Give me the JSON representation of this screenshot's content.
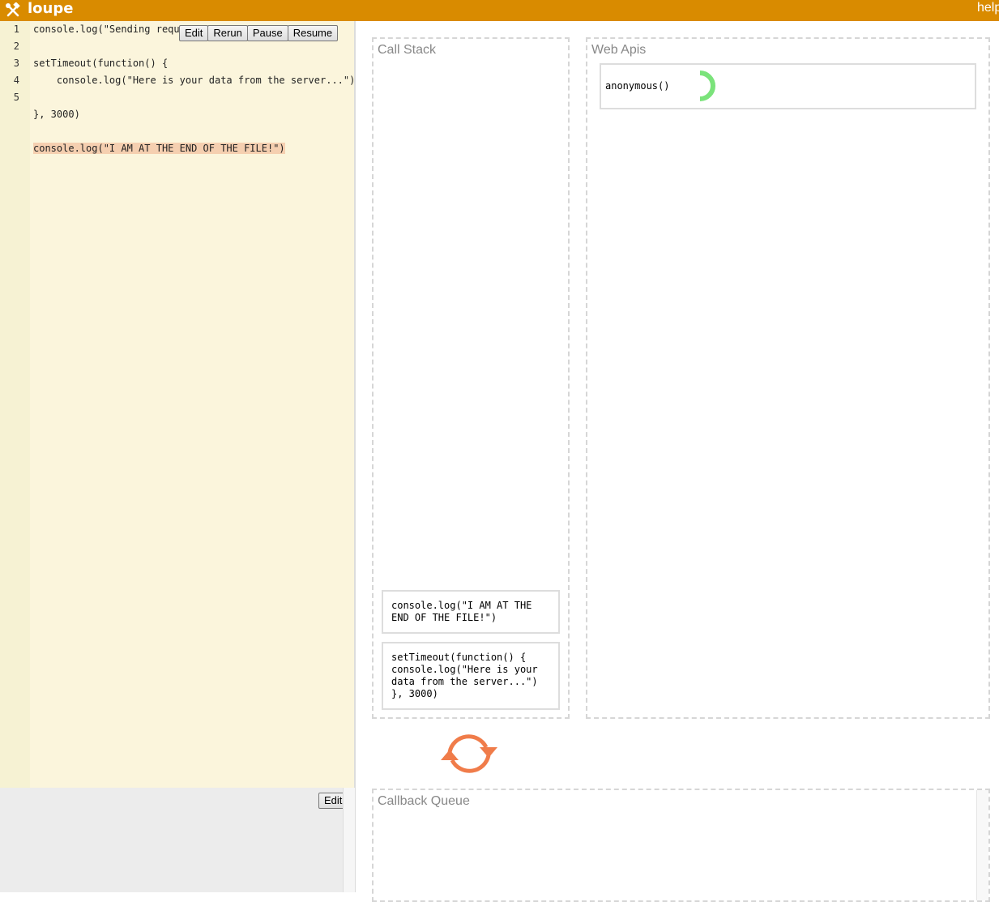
{
  "app": {
    "name": "loupe",
    "help_label": "help"
  },
  "editor": {
    "line_numbers": [
      "1",
      "2",
      "3",
      "4",
      "5"
    ],
    "lines": [
      "console.log(\"Sending requ",
      "",
      "setTimeout(function() {",
      "    console.log(\"Here is your data from the server...\")",
      "",
      "}, 3000)",
      "",
      "console.log(\"I AM AT THE END OF THE FILE!\")"
    ],
    "toolbar": {
      "edit": "Edit",
      "rerun": "Rerun",
      "pause": "Pause",
      "resume": "Resume"
    }
  },
  "console": {
    "edit": "Edit"
  },
  "call_stack": {
    "title": "Call Stack",
    "frames": [
      "console.log(\"I AM AT THE END OF THE FILE!\")",
      "setTimeout(function() { console.log(\"Here is your data from the server...\") }, 3000)"
    ]
  },
  "web_apis": {
    "title": "Web Apis",
    "entries": [
      {
        "label": "anonymous()"
      }
    ]
  },
  "callback_queue": {
    "title": "Callback Queue"
  },
  "colors": {
    "topbar": "#d98b00",
    "editor_bg": "#fbf5dc",
    "highlight": "#f5cfb0",
    "spinner": "#7be37b",
    "loop_arrows": "#f07c4a"
  },
  "icons": {
    "logo": "tools-icon",
    "event_loop": "loop-arrows-icon",
    "timer": "spinner-icon"
  }
}
